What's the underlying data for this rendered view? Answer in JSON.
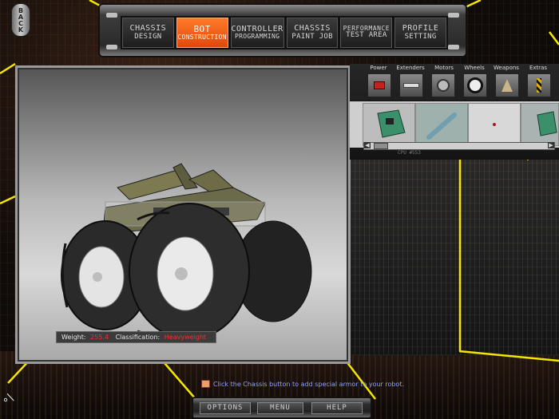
{
  "back_label": "BACK",
  "nav": {
    "tabs": [
      {
        "line1": "CHASSIS",
        "line2": "DESIGN",
        "active": false
      },
      {
        "line1": "BOT",
        "line2": "CONSTRUCTION",
        "active": true
      },
      {
        "line1": "CONTROLLER",
        "line2": "PROGRAMMING",
        "active": false
      },
      {
        "line1": "CHASSIS",
        "line2": "PAINT JOB",
        "active": false
      },
      {
        "line1": "PERFORMANCE",
        "line2": "TEST AREA",
        "active": false
      },
      {
        "line1": "PROFILE",
        "line2": "SETTING",
        "active": false
      }
    ]
  },
  "parts": {
    "categories": [
      "Power",
      "Extenders",
      "Motors",
      "Wheels",
      "Weapons",
      "Extras"
    ],
    "selected_caption": "CPU #553"
  },
  "status": {
    "weight_label": "Weight:",
    "weight_value": "255.4",
    "class_label": "Classification:",
    "class_value": "Heavyweight"
  },
  "hint": "Click the Chassis button to add special armor to your robot.",
  "bottom": {
    "options": "OPTIONS",
    "menu": "MENU",
    "help": "HELP"
  },
  "logo_glyph": "°/",
  "colors": {
    "active_tab": "#f0601a",
    "wire": "#f3e600",
    "status_value": "#ff2b2b",
    "hint_text": "#8fa0ff"
  }
}
